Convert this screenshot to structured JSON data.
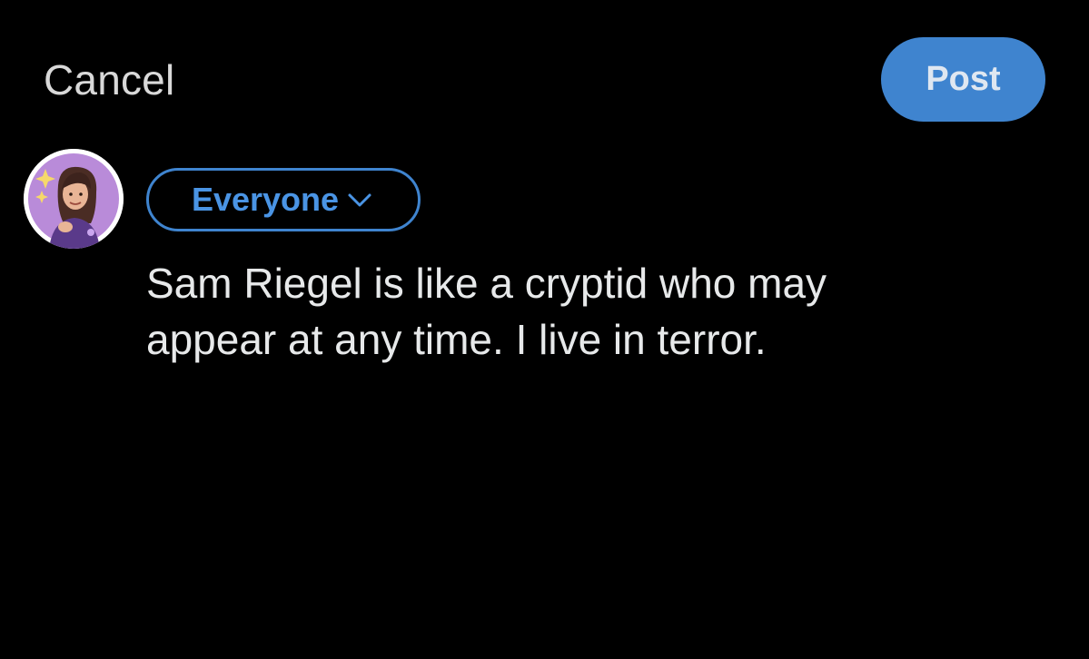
{
  "header": {
    "cancel_label": "Cancel",
    "post_label": "Post"
  },
  "composer": {
    "audience_label": "Everyone",
    "post_text": "Sam Riegel is like a cryptid who may\nappear at any time. I live in terror."
  },
  "icons": {
    "audience_dropdown": "chevron-down-icon",
    "avatar": "user-avatar"
  },
  "colors": {
    "background": "#000000",
    "accent": "#3f84cf",
    "accent_text": "#4a94e4",
    "text": "#e7e9ea",
    "muted_text": "#d9d9d9"
  }
}
